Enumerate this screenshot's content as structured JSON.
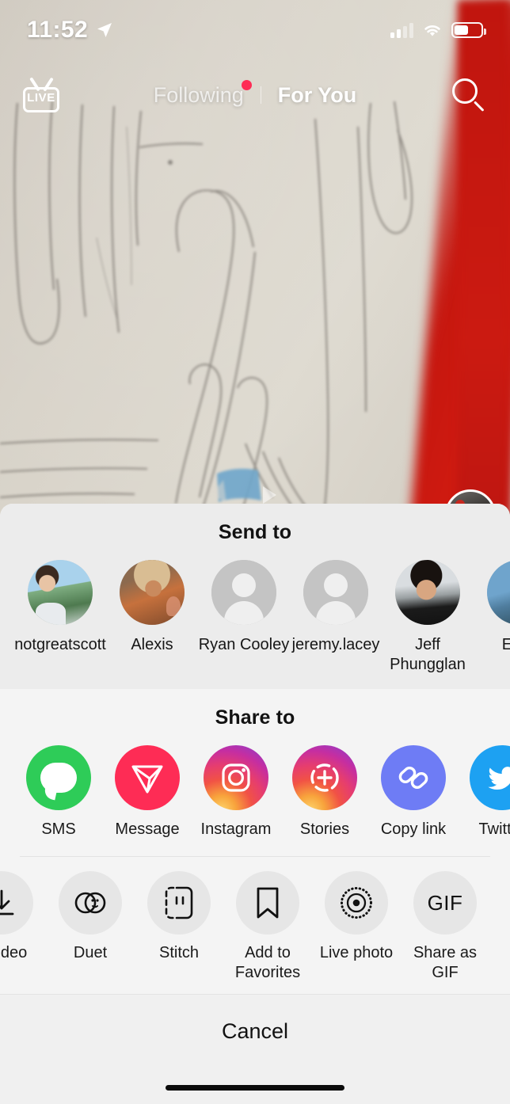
{
  "status_bar": {
    "time": "11:52",
    "location_icon": "location-arrow-icon",
    "signal_icon": "cellular-signal-icon",
    "wifi_icon": "wifi-icon",
    "battery_icon": "battery-icon",
    "battery_level_percent": 52
  },
  "top_nav": {
    "live_label": "LIVE",
    "live_icon": "live-tv-icon",
    "tab_following": "Following",
    "tab_for_you": "For You",
    "search_icon": "search-icon",
    "following_has_badge": true,
    "active_tab": "For You"
  },
  "video": {
    "play_icon": "play-triangle-icon",
    "description": "blurred pencil sketch on paper with red object at right"
  },
  "share_sheet": {
    "send_to": {
      "title": "Send to",
      "contacts": [
        {
          "name": "notgreatscott",
          "avatar": "photo"
        },
        {
          "name": "Alexis",
          "avatar": "photo"
        },
        {
          "name": "Ryan Cooley",
          "avatar": "default"
        },
        {
          "name": "jeremy.lacey",
          "avatar": "default"
        },
        {
          "name": "Jeff Phungglan",
          "avatar": "photo"
        },
        {
          "name": "Enky",
          "avatar": "photo"
        }
      ]
    },
    "share_to": {
      "title": "Share to",
      "targets": [
        {
          "label": "SMS",
          "icon": "sms-bubble-icon",
          "color": "#2ECC58"
        },
        {
          "label": "Message",
          "icon": "message-plane-icon",
          "color": "#FE2C55"
        },
        {
          "label": "Instagram",
          "icon": "instagram-camera-icon",
          "color": "#E1306C"
        },
        {
          "label": "Stories",
          "icon": "stories-plus-icon",
          "color": "#E1306C"
        },
        {
          "label": "Copy link",
          "icon": "link-chain-icon",
          "color": "#6E7CF5"
        },
        {
          "label": "Twitter",
          "icon": "twitter-bird-icon",
          "color": "#1DA1F2"
        }
      ]
    },
    "actions": [
      {
        "label": "e video",
        "icon": "download-icon"
      },
      {
        "label": "Duet",
        "icon": "duet-icon"
      },
      {
        "label": "Stitch",
        "icon": "stitch-icon"
      },
      {
        "label": "Add to Favorites",
        "icon": "bookmark-icon"
      },
      {
        "label": "Live photo",
        "icon": "live-photo-icon"
      },
      {
        "label": "Share as GIF",
        "icon": "gif-icon"
      }
    ],
    "cancel_label": "Cancel"
  }
}
